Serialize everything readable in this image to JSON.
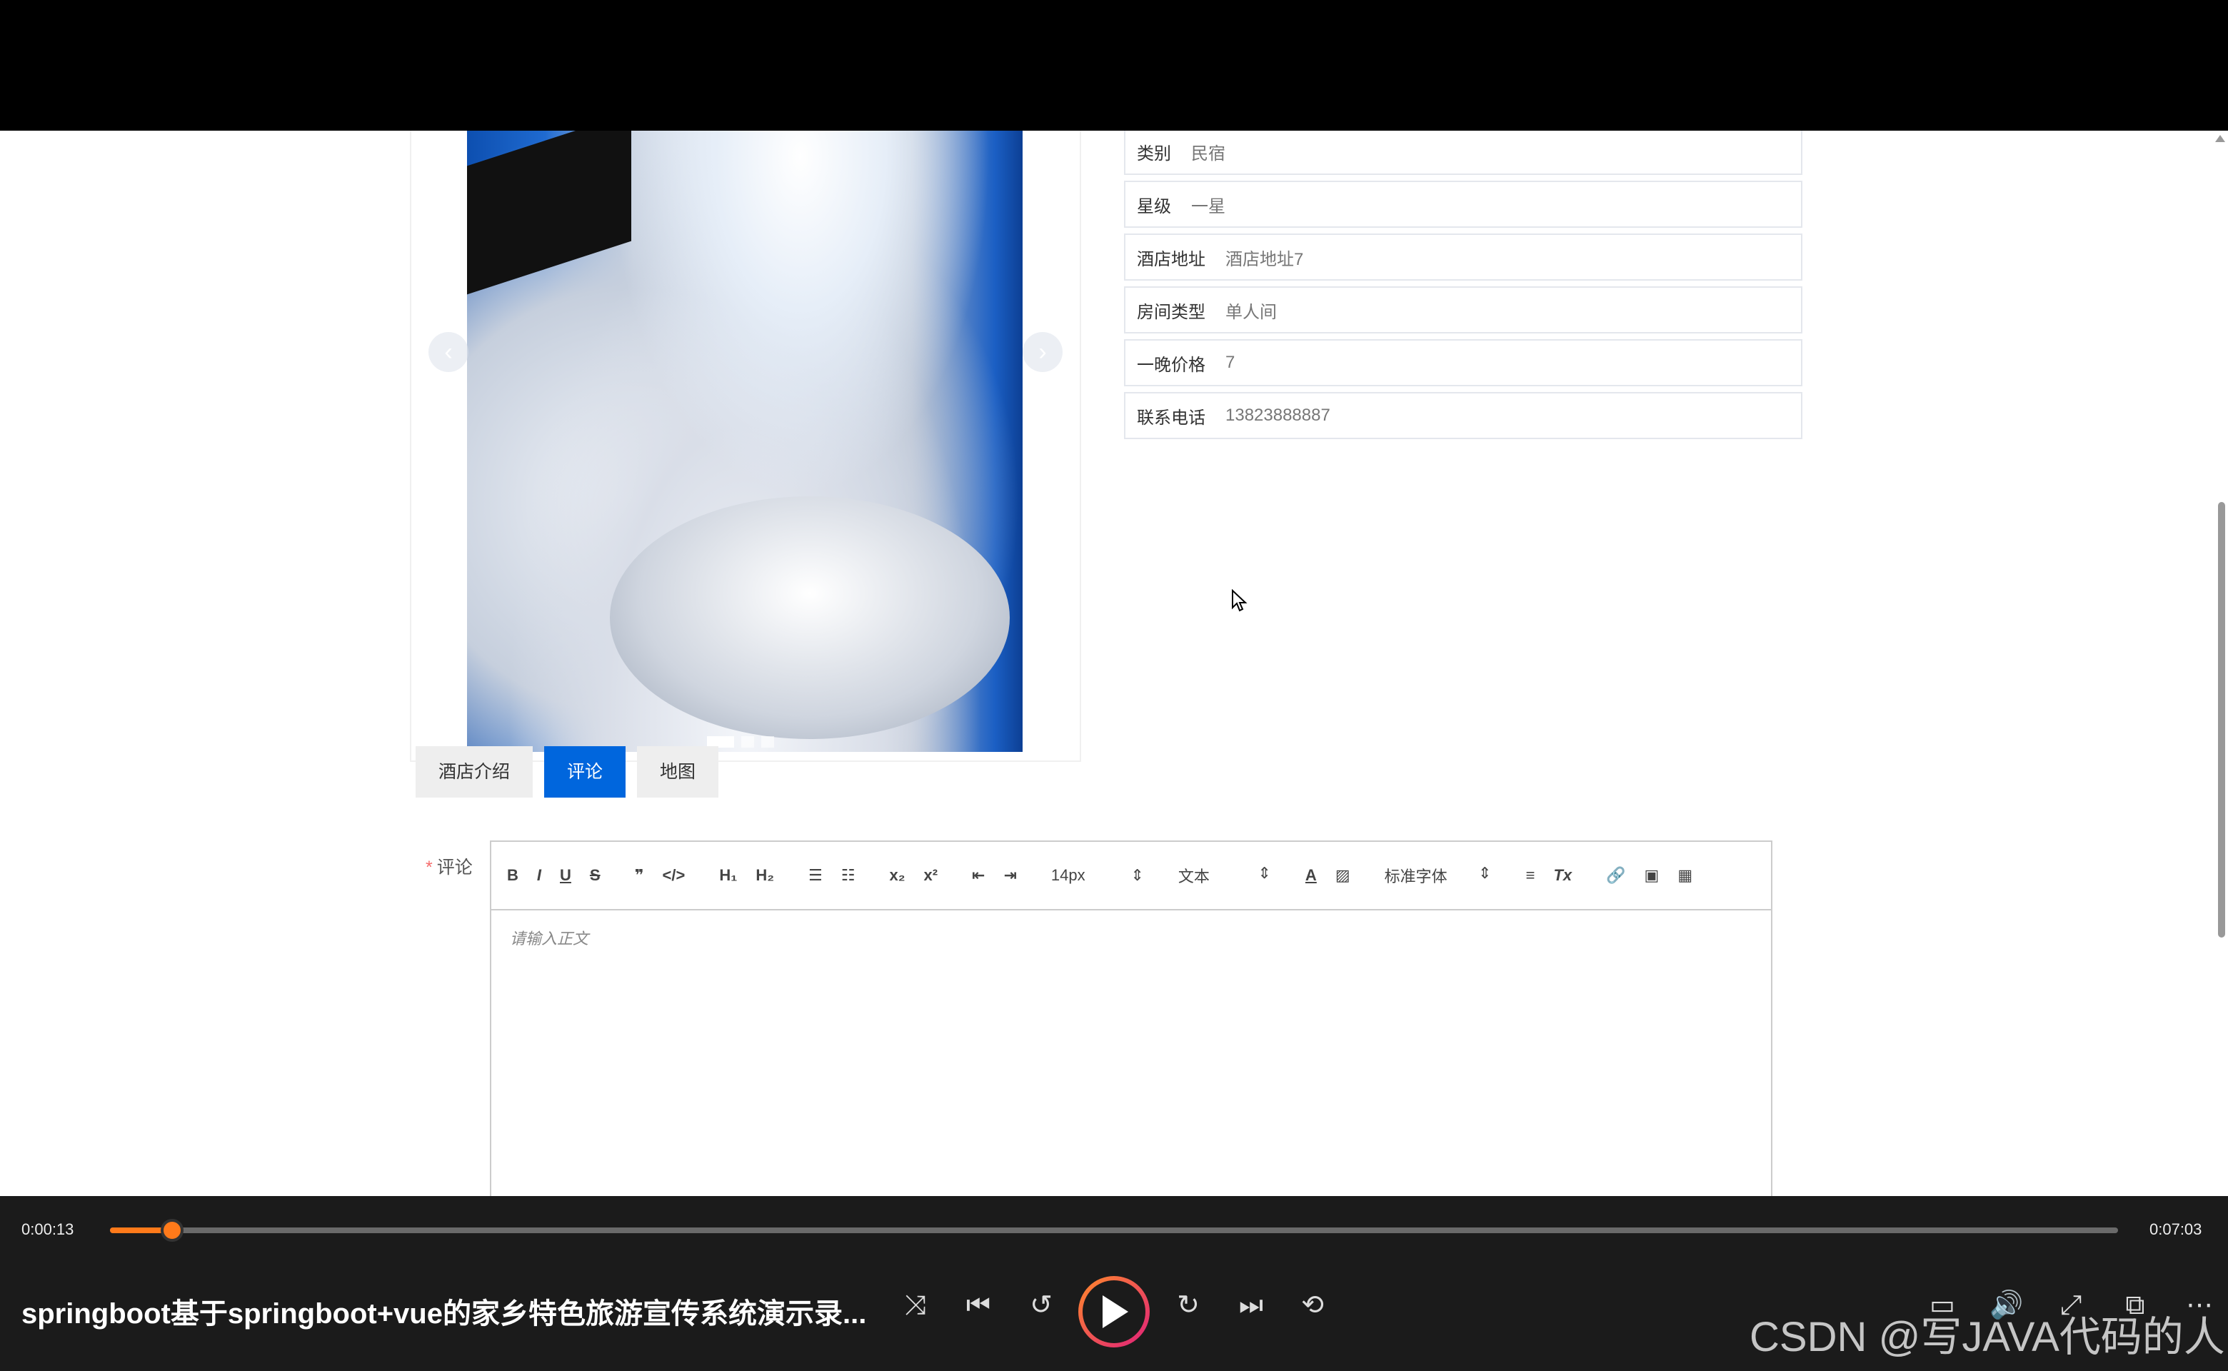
{
  "carousel": {
    "prev_icon": "chevron-left",
    "next_icon": "chevron-right",
    "dots": 3,
    "active_dot": 1
  },
  "info": [
    {
      "label": "类别",
      "value": "民宿"
    },
    {
      "label": "星级",
      "value": "一星"
    },
    {
      "label": "酒店地址",
      "value": "酒店地址7"
    },
    {
      "label": "房间类型",
      "value": "单人间"
    },
    {
      "label": "一晚价格",
      "value": "7"
    },
    {
      "label": "联系电话",
      "value": "13823888887"
    }
  ],
  "tabs": [
    {
      "label": "酒店介绍",
      "active": false
    },
    {
      "label": "评论",
      "active": true
    },
    {
      "label": "地图",
      "active": false
    }
  ],
  "comment": {
    "required_mark": "*",
    "label": "评论",
    "placeholder": "请输入正文",
    "toolbar": {
      "bold": "B",
      "italic": "I",
      "underline": "U",
      "strike": "S",
      "quote": "❞",
      "code": "</>",
      "h1": "H₁",
      "h2": "H₂",
      "ordered_list": "☰",
      "bullet_list": "☷",
      "subscript": "x₂",
      "superscript": "x²",
      "outdent": "⇤",
      "indent": "⇥",
      "size": "14px",
      "header": "文本",
      "font": "标准字体",
      "align": "≡",
      "clean": "Tx",
      "link": "🔗",
      "image": "▣",
      "video": "▦"
    }
  },
  "player": {
    "current_time": "0:00:13",
    "total_time": "0:07:03",
    "progress_fraction": 0.031,
    "title": "springboot基于springboot+vue的家乡特色旅游宣传系统演示录...",
    "watermark": "CSDN @写JAVA代码的人",
    "accent_color": "#ff7a1a"
  }
}
